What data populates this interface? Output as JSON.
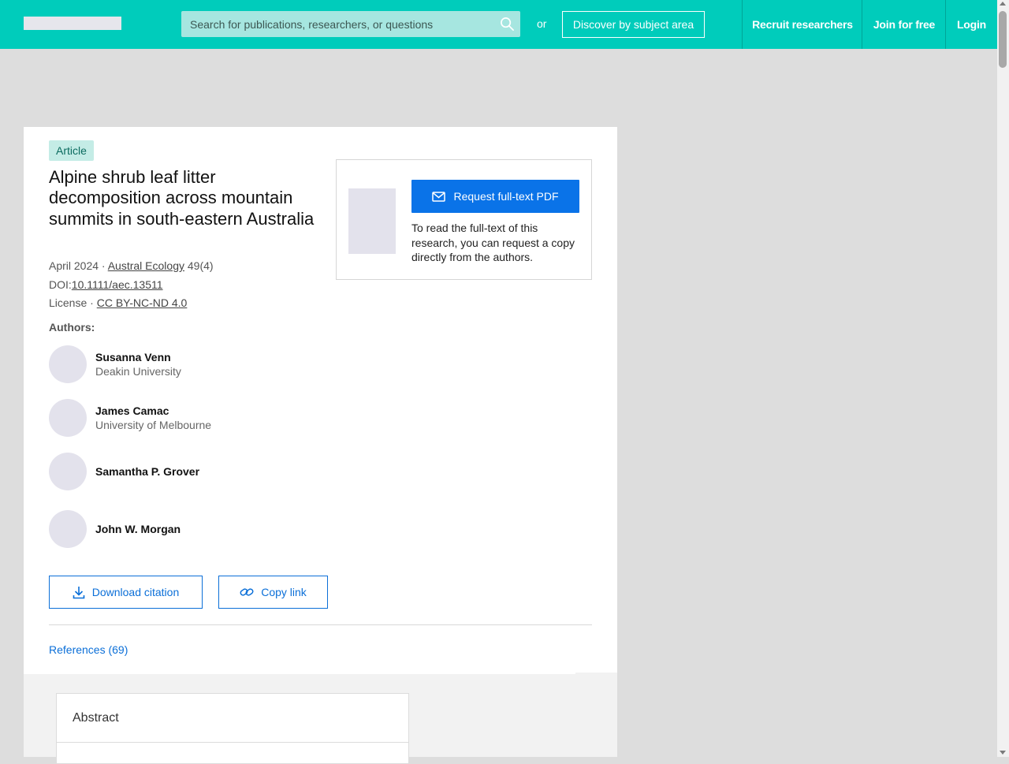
{
  "header": {
    "search_placeholder": "Search for publications, researchers, or questions",
    "or_text": "or",
    "discover_label": "Discover by subject area",
    "nav": {
      "recruit": "Recruit researchers",
      "join": "Join for free",
      "login": "Login"
    }
  },
  "article": {
    "badge": "Article",
    "title": "Alpine shrub leaf litter decomposition across mountain summits in south-eastern Australia",
    "date": "April 2024",
    "separator": " · ",
    "journal": "Austral Ecology",
    "issue": " 49(4)",
    "doi_label": "DOI:",
    "doi": "10.1111/aec.13511",
    "license_label": "License",
    "license": "CC BY-NC-ND 4.0",
    "authors_label": "Authors:",
    "authors": [
      {
        "name": "Susanna Venn",
        "institution": "Deakin University"
      },
      {
        "name": "James Camac",
        "institution": "University of Melbourne"
      },
      {
        "name": "Samantha P. Grover",
        "institution": ""
      },
      {
        "name": "John W. Morgan",
        "institution": ""
      }
    ],
    "download_citation": "Download citation",
    "copy_link": "Copy link",
    "references": "References (69)"
  },
  "request": {
    "button": "Request full-text PDF",
    "text": "To read the full-text of this research, you can request a copy directly from the authors."
  },
  "abstract": {
    "title": "Abstract"
  },
  "colors": {
    "header_bg": "#00ccbb",
    "primary_blue": "#0a73e8",
    "badge_bg": "#c4ece6"
  },
  "icons": [
    "search-icon",
    "mail-icon",
    "download-icon",
    "link-icon"
  ]
}
